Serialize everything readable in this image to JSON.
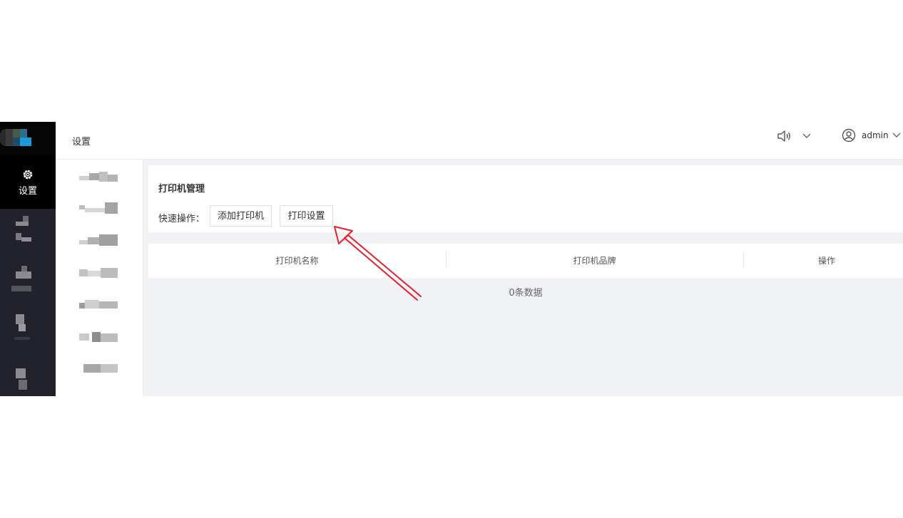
{
  "header": {
    "page_title": "设置",
    "user_name": "admin"
  },
  "rail": {
    "active_label": "设置"
  },
  "card": {
    "title": "打印机管理",
    "quick_ops_label": "快速操作：",
    "add_printer_label": "添加打印机",
    "print_settings_label": "打印设置"
  },
  "table": {
    "columns": [
      "打印机名称",
      "打印机品牌",
      "操作"
    ],
    "rows": [],
    "empty_text": "0条数据"
  },
  "colors": {
    "rail_bg": "#21222b",
    "main_bg": "#f0f2f5",
    "annotation_arrow": "#e8202a"
  }
}
